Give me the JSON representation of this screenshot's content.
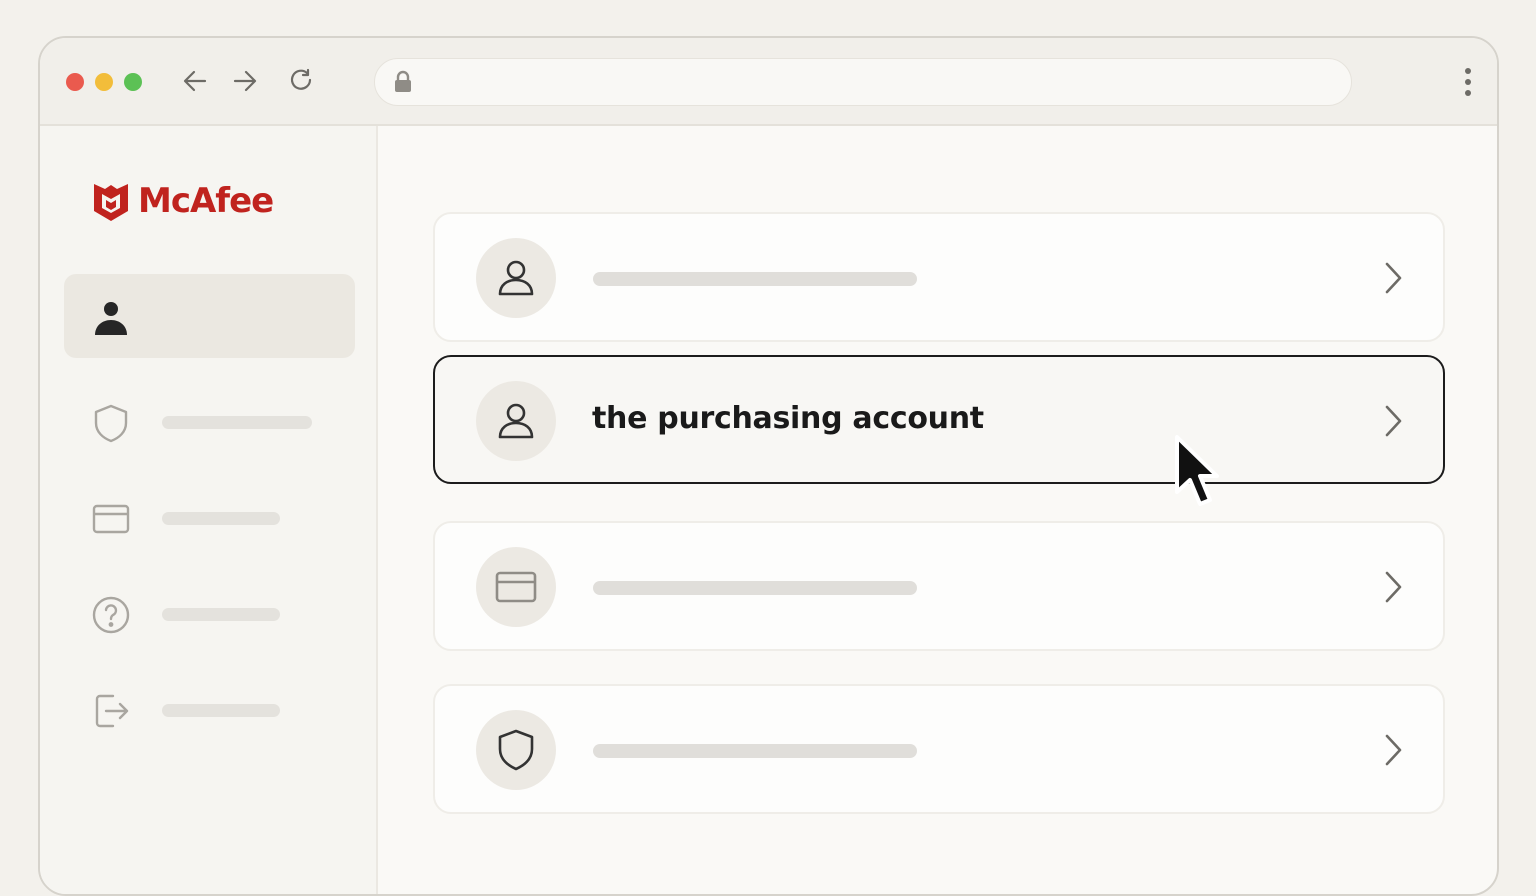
{
  "browser": {
    "address": "",
    "colors": {
      "close": "#ea5a4e",
      "minimize": "#f2bd3a",
      "maximize": "#5cc155"
    },
    "icons": [
      "back-arrow-icon",
      "forward-arrow-icon",
      "reload-icon",
      "lock-icon",
      "more-vert-icon"
    ]
  },
  "sidebar": {
    "brand": {
      "name": "McAfee",
      "color": "#c0231e"
    },
    "items": [
      {
        "icon": "user-icon",
        "label": "",
        "active": true
      },
      {
        "icon": "shield-icon",
        "label": ""
      },
      {
        "icon": "credit-card-icon",
        "label": ""
      },
      {
        "icon": "help-circle-icon",
        "label": ""
      },
      {
        "icon": "sign-out-icon",
        "label": ""
      }
    ]
  },
  "main": {
    "cards": [
      {
        "icon": "user-icon",
        "label": ""
      },
      {
        "icon": "user-icon",
        "label": "the purchasing account",
        "selected": true
      },
      {
        "icon": "credit-card-icon",
        "label": ""
      },
      {
        "icon": "shield-icon",
        "label": ""
      }
    ]
  }
}
